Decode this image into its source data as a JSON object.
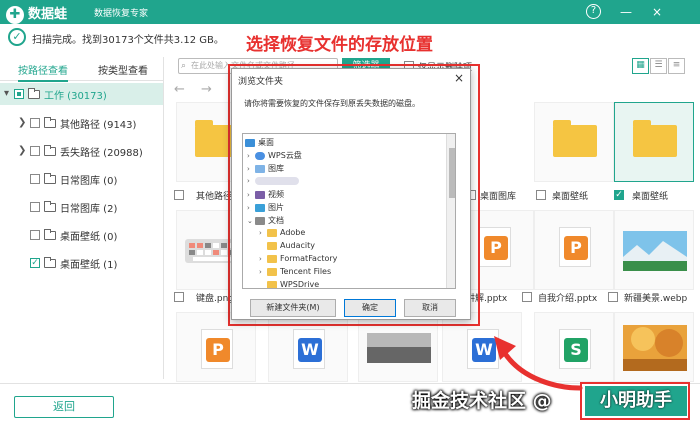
{
  "app": {
    "name": "数据蛙",
    "subtitle": "数据恢复专家",
    "help": "?",
    "minimize": "—",
    "close": "×"
  },
  "status": {
    "text": "扫描完成。找到30173个文件共3.12 GB。"
  },
  "annotation": {
    "title": "选择恢复文件的存放位置",
    "watermark": "掘金技术社区 @",
    "author": "小明助手"
  },
  "sidebar": {
    "tabs": [
      {
        "label": "按路径查看",
        "active": true
      },
      {
        "label": "按类型查看",
        "active": false
      }
    ],
    "items": [
      {
        "label": "工作 (30173)"
      },
      {
        "label": "其他路径 (9143)"
      },
      {
        "label": "丢失路径 (20988)"
      },
      {
        "label": "日常图库 (0)"
      },
      {
        "label": "日常图库 (2)"
      },
      {
        "label": "桌面壁纸 (0)"
      },
      {
        "label": "桌面壁纸 (1)"
      }
    ]
  },
  "toolbar": {
    "search_placeholder": "在此处输入文件名或文件路径",
    "filter_label": "筛选器",
    "only_deleted_label": "仅显示删除项"
  },
  "grid": {
    "labels": [
      "其他路径",
      "桌面图库",
      "桌面壁纸",
      "桌面壁纸",
      "键盘.png",
      "讲解.pptx",
      "自我介绍.pptx",
      "新疆美景.webp"
    ]
  },
  "dialog": {
    "title": "浏览文件夹",
    "close": "×",
    "message": "请你将需要恢复的文件保存到原丢失数据的磁盘。",
    "tree": [
      {
        "label": "桌面"
      },
      {
        "label": "WPS云盘"
      },
      {
        "label": "图库"
      },
      {
        "label": "视频"
      },
      {
        "label": "图片"
      },
      {
        "label": "文档"
      },
      {
        "label": "Adobe"
      },
      {
        "label": "Audacity"
      },
      {
        "label": "FormatFactory"
      },
      {
        "label": "Tencent Files"
      },
      {
        "label": "WPSDrive"
      }
    ],
    "new_folder": "新建文件夹(M)",
    "ok": "确定",
    "cancel": "取消"
  },
  "bottom": {
    "back": "返回"
  },
  "colors": {
    "accent": "#20a58d",
    "annotation": "#e8312f",
    "folder": "#f5c542",
    "ppt": "#f0892b",
    "word": "#2c6fd6",
    "sheet": "#21a366"
  }
}
